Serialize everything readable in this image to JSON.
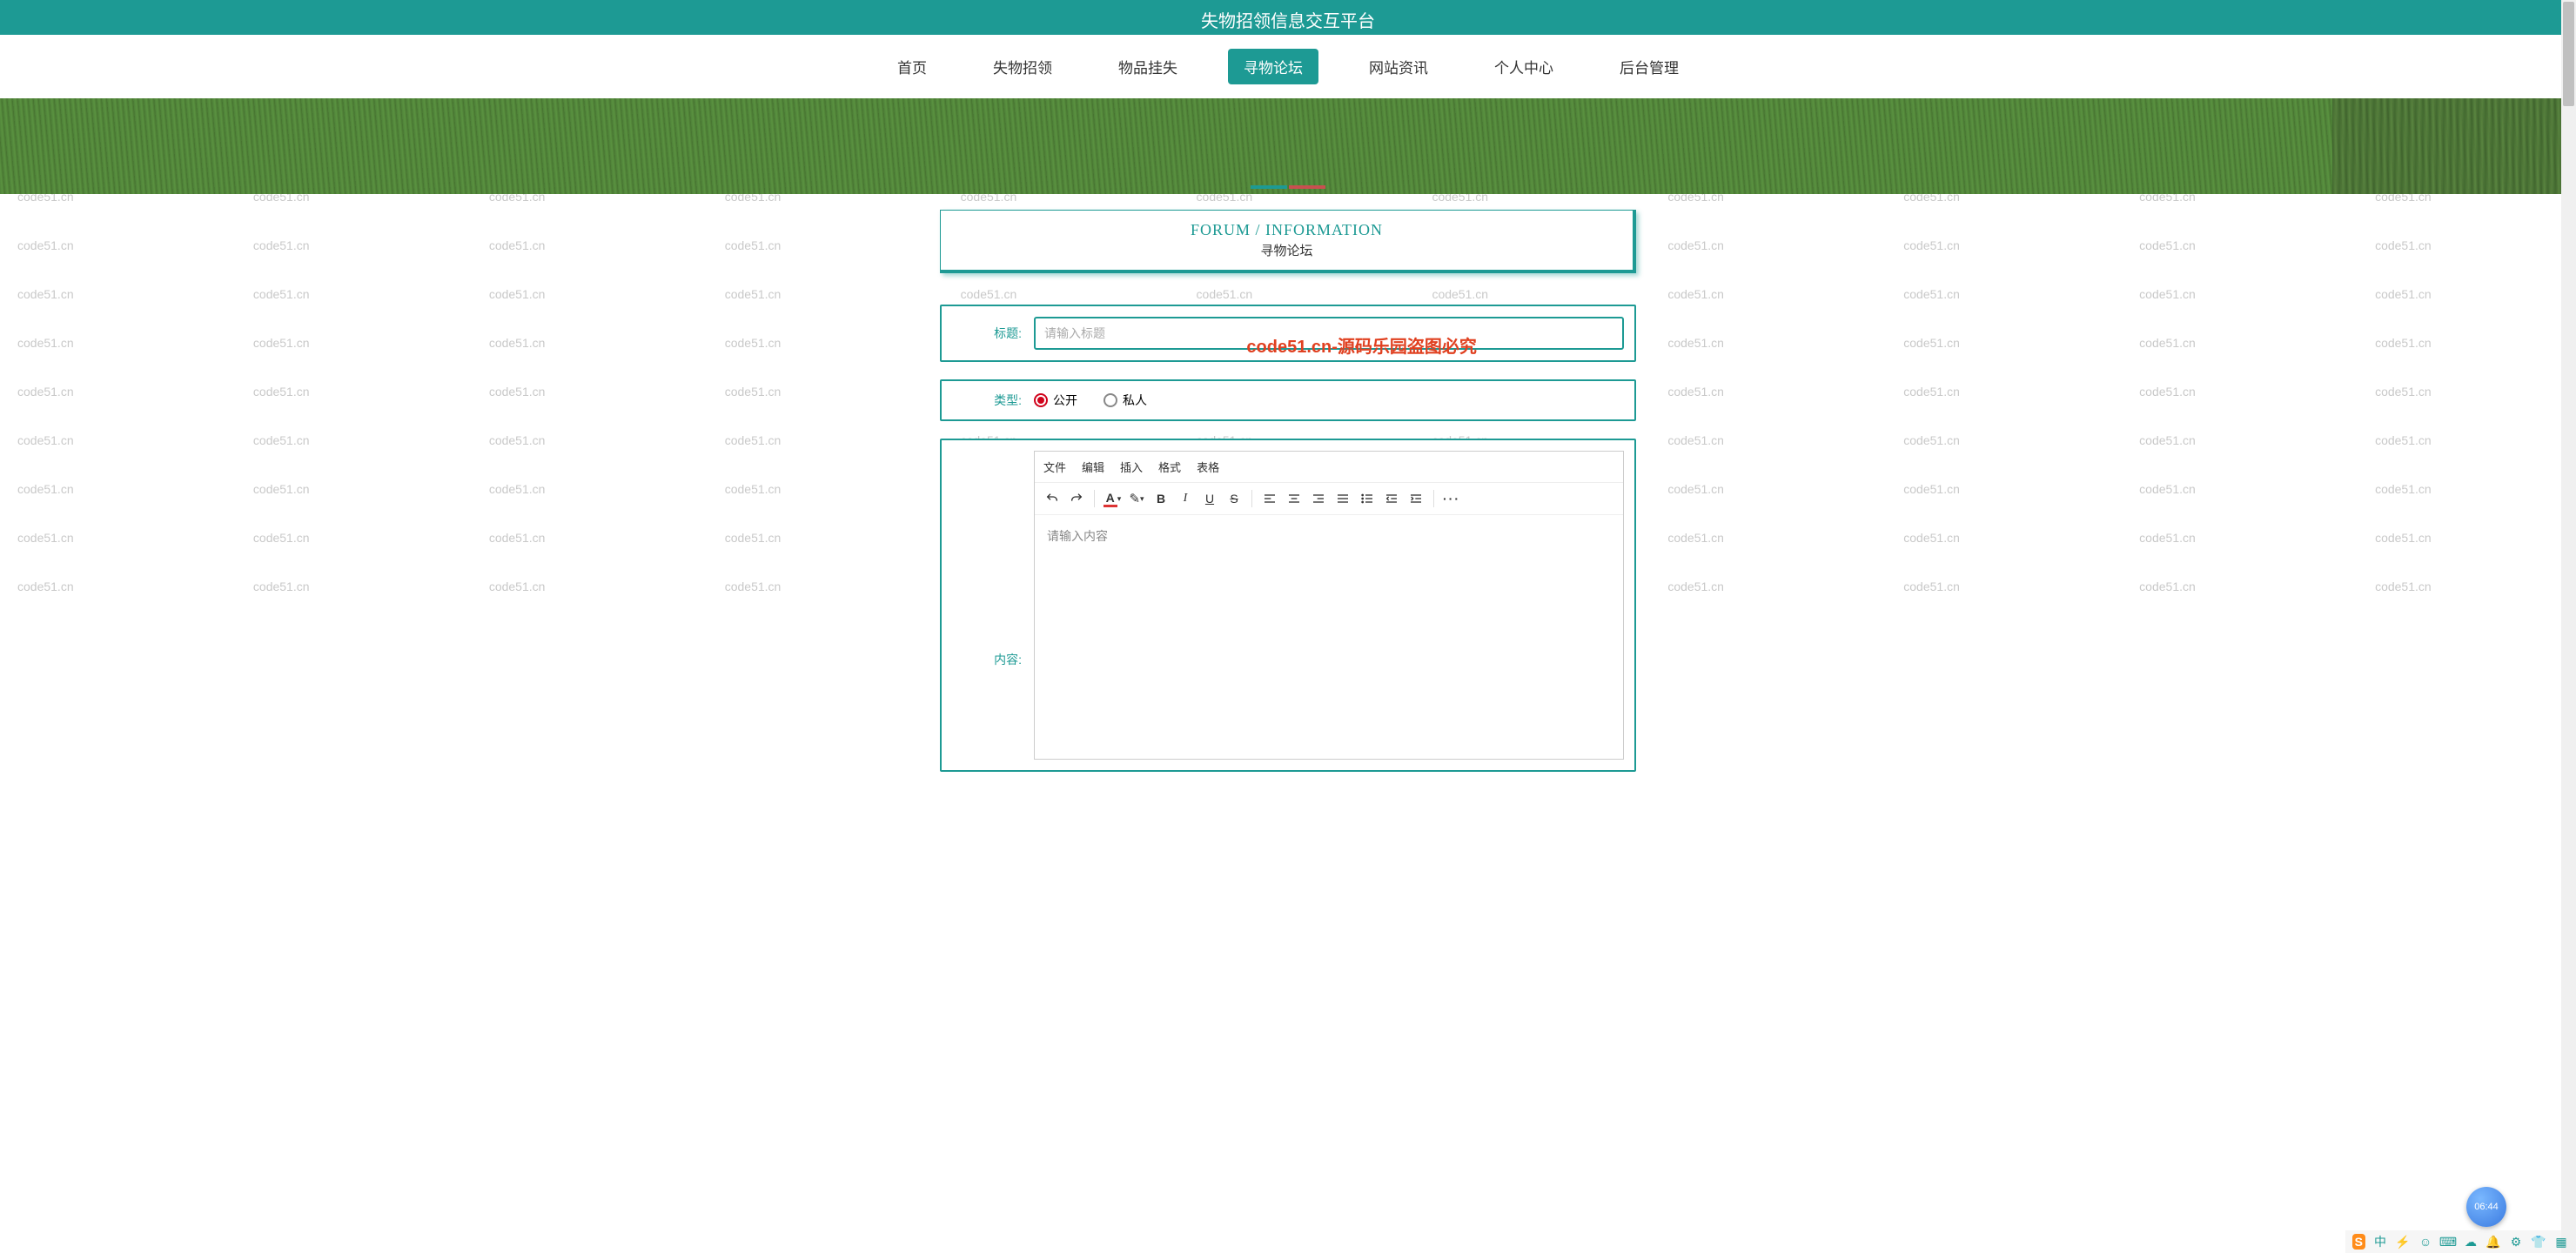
{
  "header": {
    "title": "失物招领信息交互平台"
  },
  "nav": {
    "items": [
      {
        "label": "首页",
        "active": false
      },
      {
        "label": "失物招领",
        "active": false
      },
      {
        "label": "物品挂失",
        "active": false
      },
      {
        "label": "寻物论坛",
        "active": true
      },
      {
        "label": "网站资讯",
        "active": false
      },
      {
        "label": "个人中心",
        "active": false
      },
      {
        "label": "后台管理",
        "active": false
      }
    ]
  },
  "panel": {
    "title_en": "FORUM / INFORMATION",
    "title_cn": "寻物论坛"
  },
  "form": {
    "title_label": "标题:",
    "title_placeholder": "请输入标题",
    "type_label": "类型:",
    "type_options": [
      {
        "label": "公开",
        "checked": true
      },
      {
        "label": "私人",
        "checked": false
      }
    ],
    "content_label": "内容:",
    "content_placeholder": "请输入内容"
  },
  "editor": {
    "menu": [
      "文件",
      "编辑",
      "插入",
      "格式",
      "表格"
    ],
    "toolbar_icons": [
      "undo",
      "redo",
      "sep",
      "text-color",
      "bg-color",
      "bold",
      "italic",
      "underline",
      "strike",
      "sep",
      "align-left",
      "align-center",
      "align-right",
      "align-justify",
      "list-bullet",
      "indent-decrease",
      "indent-increase",
      "sep",
      "more"
    ]
  },
  "watermark": {
    "text": "code51.cn",
    "red_text": "code51.cn-源码乐园盗图必究"
  },
  "clock": {
    "time": "06:44"
  },
  "taskbar": {
    "ime": "S",
    "lang": "中",
    "icons": [
      "power",
      "smile",
      "keyboard",
      "cloud",
      "notify",
      "settings",
      "person",
      "grid"
    ]
  }
}
